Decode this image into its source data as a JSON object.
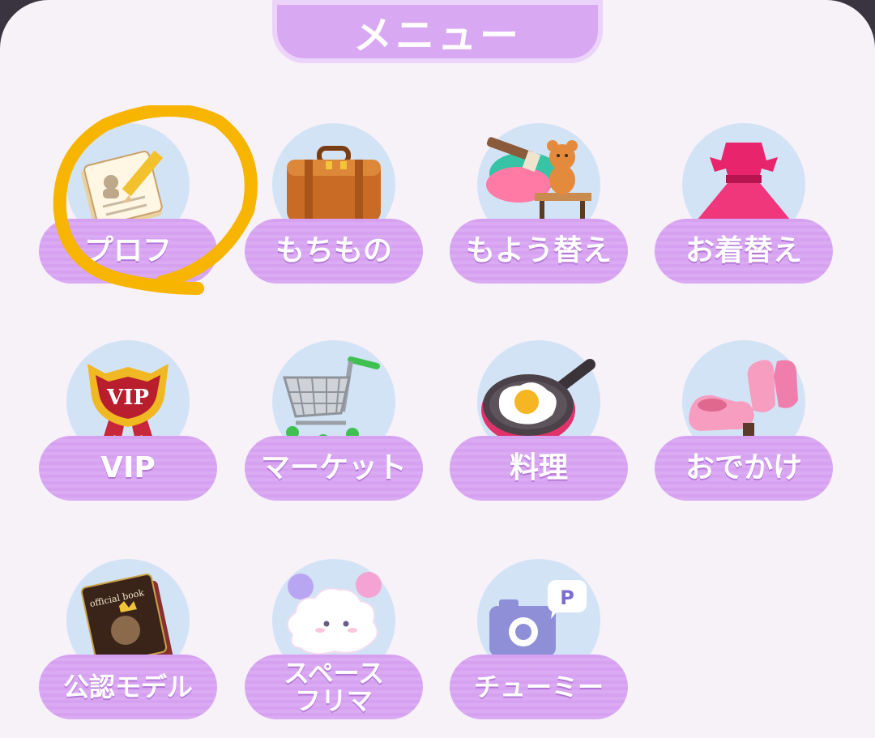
{
  "header": {
    "title": "メニュー"
  },
  "menu": {
    "items": [
      {
        "label": "プロフ",
        "icon": "profile-notepad-icon"
      },
      {
        "label": "もちもの",
        "icon": "suitcase-icon"
      },
      {
        "label": "もよう替え",
        "icon": "paint-brush-bear-icon"
      },
      {
        "label": "お着替え",
        "icon": "pink-dress-icon"
      },
      {
        "label": "VIP",
        "icon": "vip-badge-icon"
      },
      {
        "label": "マーケット",
        "icon": "shopping-cart-icon"
      },
      {
        "label": "料理",
        "icon": "frying-pan-egg-icon"
      },
      {
        "label": "おでかけ",
        "icon": "pink-shoes-icon"
      },
      {
        "label": "公認モデル",
        "icon": "official-book-icon"
      },
      {
        "label": "スペース\nフリマ",
        "icon": "cloud-character-icon"
      },
      {
        "label": "チューミー",
        "icon": "camera-icon"
      }
    ]
  },
  "icon_text": {
    "vip_badge": "VIP",
    "official_book": "official book",
    "chumee_bubble": "P"
  },
  "colors": {
    "label_purple": "#d6a1f1",
    "circle_blue": "#d3e3f6",
    "highlight_yellow": "#f7b500"
  }
}
